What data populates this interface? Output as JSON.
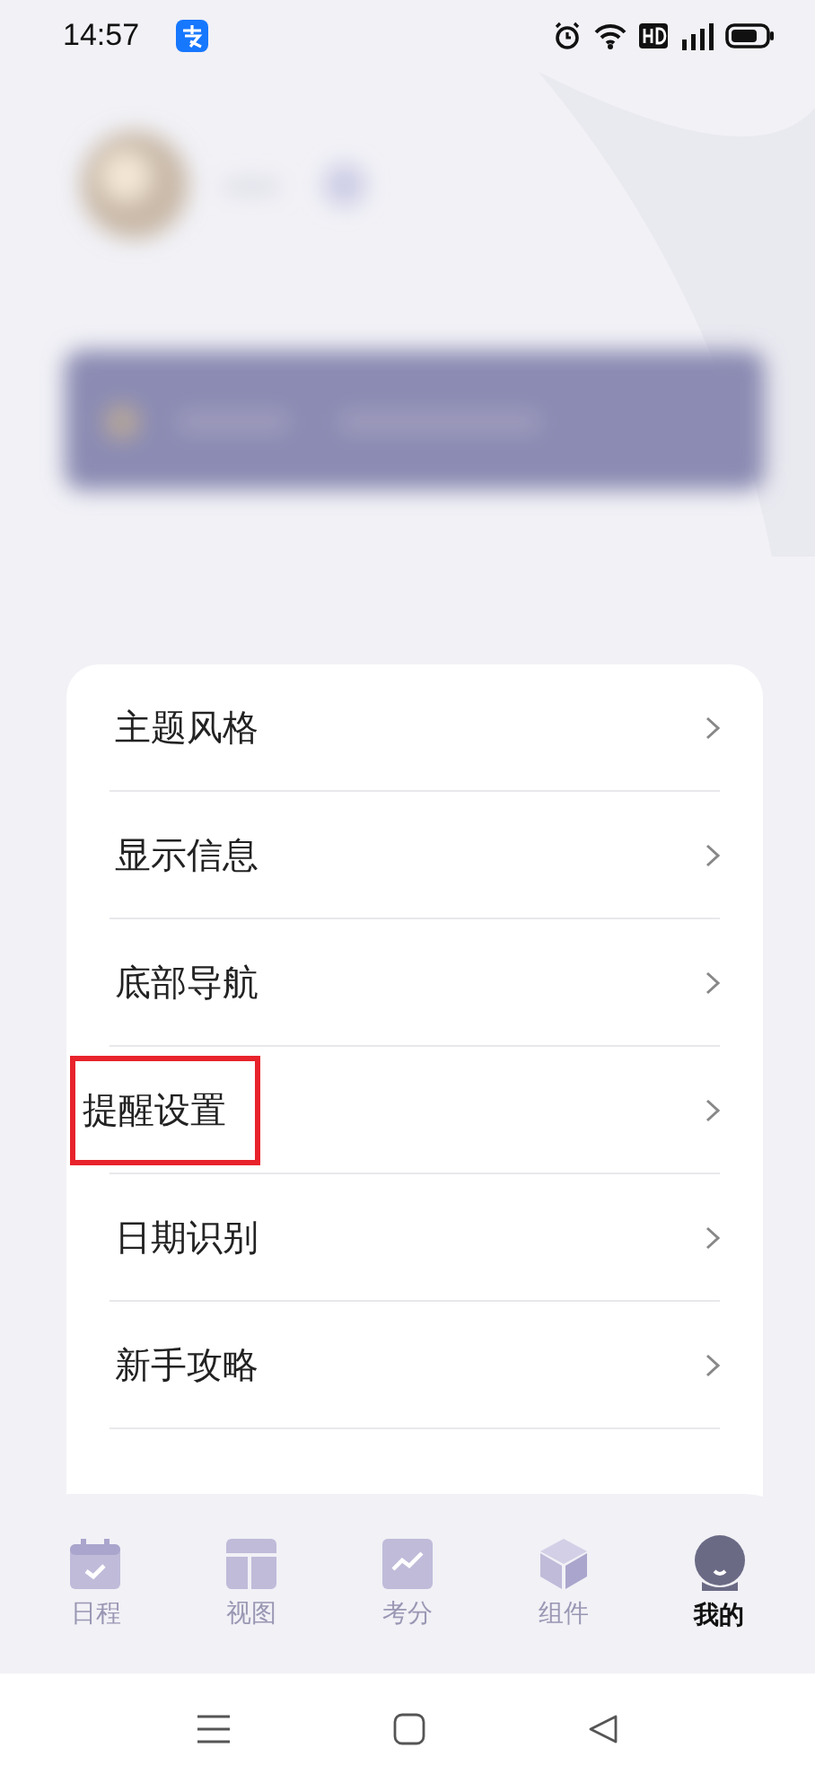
{
  "status_bar": {
    "time": "14:57"
  },
  "settings_menu": [
    {
      "label": "主题风格",
      "highlighted": false
    },
    {
      "label": "显示信息",
      "highlighted": false
    },
    {
      "label": "底部导航",
      "highlighted": false
    },
    {
      "label": "提醒设置",
      "highlighted": true
    },
    {
      "label": "日期识别",
      "highlighted": false
    },
    {
      "label": "新手攻略",
      "highlighted": false
    }
  ],
  "tab_bar": [
    {
      "label": "日程",
      "kind": "calendar",
      "selected": false
    },
    {
      "label": "视图",
      "kind": "layout",
      "selected": false
    },
    {
      "label": "考分",
      "kind": "chart",
      "selected": false
    },
    {
      "label": "组件",
      "kind": "cube",
      "selected": false
    },
    {
      "label": "我的",
      "kind": "avatar",
      "selected": true
    }
  ]
}
